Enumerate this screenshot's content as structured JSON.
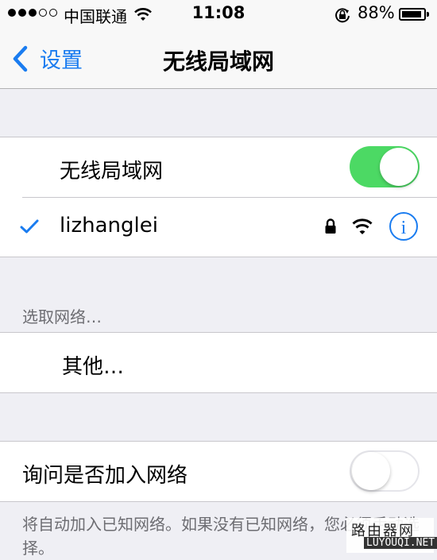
{
  "status_bar": {
    "carrier": "中国联通",
    "time": "11:08",
    "battery": "88%"
  },
  "nav": {
    "back_label": "设置",
    "title": "无线局域网"
  },
  "wifi_group": {
    "toggle_label": "无线局域网",
    "toggle_on": true,
    "connected_network": "lizhanglei"
  },
  "choose_network": {
    "header": "选取网络…",
    "other_label": "其他…"
  },
  "ask_join": {
    "label": "询问是否加入网络",
    "toggle_on": false,
    "footer": "将自动加入已知网络。如果没有已知网络，您必须手动选择。"
  },
  "watermark": {
    "cn": "路由器网",
    "en": "LUYOUQI.NET"
  },
  "colors": {
    "accent": "#1a7cf0",
    "toggle_on": "#4cd964",
    "background": "#efeff4"
  }
}
